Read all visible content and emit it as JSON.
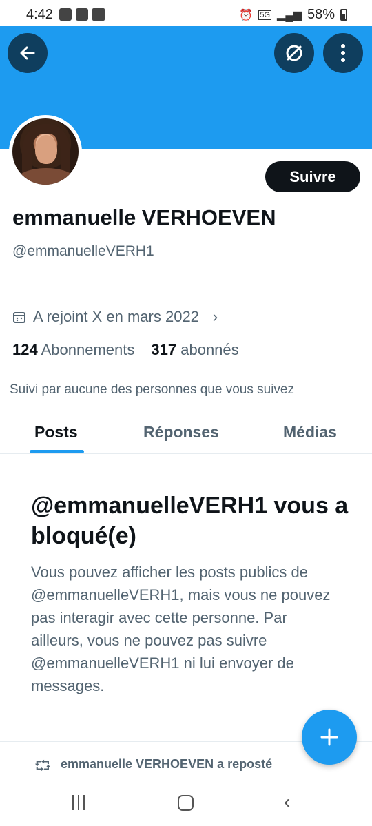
{
  "status_bar": {
    "time": "4:42",
    "network": "5G",
    "battery": "58%"
  },
  "header": {
    "back_icon": "arrow-left-icon",
    "grok_icon": "grok-icon",
    "more_icon": "more-vertical-icon",
    "banner_color": "#1d9bf0"
  },
  "profile": {
    "follow_label": "Suivre",
    "display_name": "emmanuelle VERHOEVEN",
    "handle": "@emmanuelleVERH1",
    "joined": "A rejoint X en mars 2022",
    "following_count": "124",
    "following_label": "Abonnements",
    "followers_count": "317",
    "followers_label": "abonnés",
    "followed_by": "Suivi par aucune des personnes que vous suivez"
  },
  "tabs": [
    {
      "label": "Posts",
      "active": true
    },
    {
      "label": "Réponses",
      "active": false
    },
    {
      "label": "Médias",
      "active": false
    }
  ],
  "blocked": {
    "title": "@emmanuelleVERH1 vous a bloqué(e)",
    "text": "Vous pouvez afficher les posts publics de @emmanuelleVERH1, mais vous ne pouvez pas interagir avec cette personne. Par ailleurs, vous ne pouvez pas suivre @emmanuelleVERH1 ni lui envoyer de messages."
  },
  "repost": {
    "text": "emmanuelle VERHOEVEN a reposté"
  },
  "accent_color": "#1d9bf0"
}
